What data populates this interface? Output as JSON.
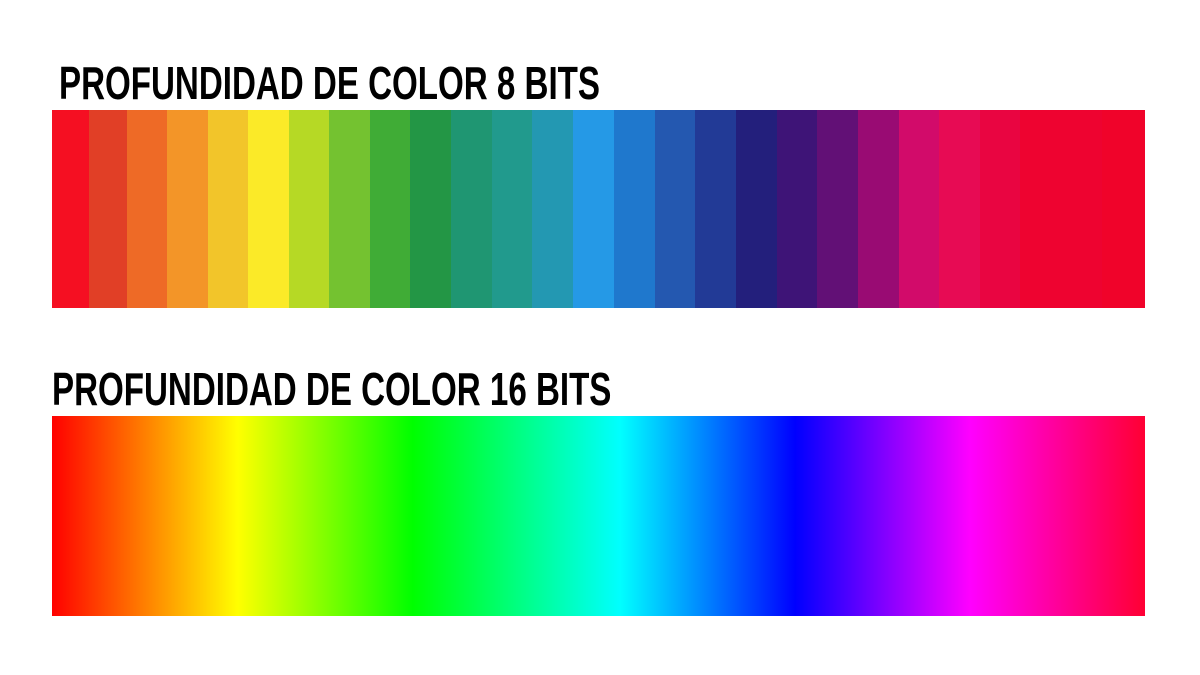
{
  "panels": [
    {
      "title": "PROFUNDIDAD DE COLOR 8 BITS",
      "bands": [
        "#f50f22",
        "#e13f26",
        "#ee6a26",
        "#f39528",
        "#f2c52a",
        "#fbea28",
        "#b6d925",
        "#74c230",
        "#40ac36",
        "#239645",
        "#1f9672",
        "#219a8d",
        "#2398b2",
        "#2599e6",
        "#1f78cd",
        "#2458b0",
        "#223a96",
        "#231f7c",
        "#3e1477",
        "#621076",
        "#990b73",
        "#d20b6a",
        "#e70b54",
        "#e90541",
        "#ee0330",
        "#ee0330",
        "#f0032a"
      ]
    },
    {
      "title": "PROFUNDIDAD DE COLOR 16 BITS",
      "gradient_stops": [
        "#ff0000",
        "#ffff00",
        "#00ff00",
        "#00ffff",
        "#0000ff",
        "#ff00ff",
        "#ff0033"
      ]
    }
  ]
}
